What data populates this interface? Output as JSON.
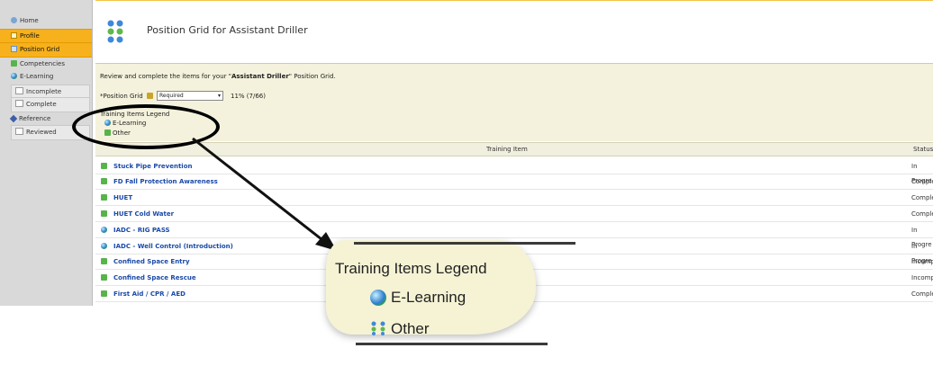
{
  "sidebar": {
    "items": [
      {
        "label": "Home"
      },
      {
        "label": "Profile"
      },
      {
        "label": "Position Grid"
      },
      {
        "label": "Competencies"
      },
      {
        "label": "E-Learning"
      },
      {
        "label": "Incomplete"
      },
      {
        "label": "Complete"
      },
      {
        "label": "Reference"
      },
      {
        "label": "Reviewed"
      }
    ]
  },
  "header": {
    "title": "Position Grid for Assistant Driller"
  },
  "panel": {
    "intro_prefix": "Review and complete the items for your \"",
    "intro_bold": "Assistant Driller",
    "intro_suffix": "\" Position Grid.",
    "grid_label": "*Position Grid",
    "grid_select": "Required",
    "progress": "11% (7/66)",
    "legend_title": "Training Items Legend",
    "legend_elearning": "E-Learning",
    "legend_other": "Other"
  },
  "table": {
    "headers": [
      "Training Item",
      "Status"
    ],
    "rows": [
      {
        "item": "Stuck Pipe Prevention",
        "status": "In Progre",
        "icon": "other-icon"
      },
      {
        "item": "FD Fall Protection Awareness",
        "status": "Complete",
        "icon": "other-icon"
      },
      {
        "item": "HUET",
        "status": "Complete",
        "icon": "other-icon"
      },
      {
        "item": "HUET Cold Water",
        "status": "Complete",
        "icon": "other-icon"
      },
      {
        "item": "IADC - RIG PASS",
        "status": "In Progre",
        "icon": "globe-icon"
      },
      {
        "item": "IADC - Well Control (Introduction)",
        "status": "In Progre",
        "icon": "globe-icon"
      },
      {
        "item": "Confined Space Entry",
        "status": "Incomplet",
        "icon": "other-icon"
      },
      {
        "item": "Confined Space Rescue",
        "status": "Incomplet",
        "icon": "other-icon"
      },
      {
        "item": "First Aid / CPR / AED",
        "status": "Complete",
        "icon": "other-icon"
      }
    ]
  },
  "callout": {
    "title": "Training Items Legend",
    "elearning": "E-Learning",
    "other": "Other"
  },
  "colors": {
    "accent": "#f6b11c",
    "panel_bg": "#f4f2dc",
    "link": "#1a4aa8"
  }
}
